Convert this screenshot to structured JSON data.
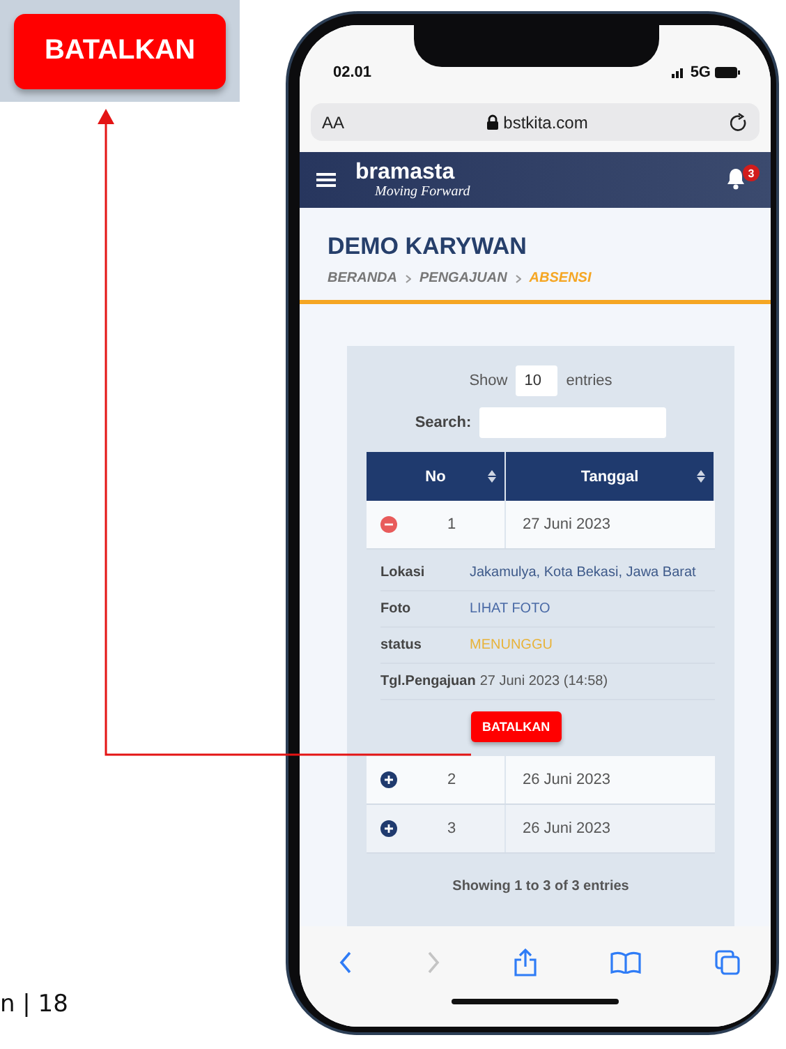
{
  "callout": {
    "button": "BATALKAN"
  },
  "footer": {
    "page_text": "n | 18"
  },
  "phone": {
    "status_bar": {
      "time": "02.01",
      "network": "5G"
    },
    "browser": {
      "text_size": "AA",
      "url": "bstkita.com"
    },
    "navbar": {
      "logo": "bramasta",
      "tagline": "Moving Forward",
      "notification_count": "3"
    },
    "header": {
      "title": "DEMO KARYWAN",
      "breadcrumb": [
        {
          "label": "BERANDA",
          "selected": false
        },
        {
          "label": "PENGAJUAN",
          "selected": false
        },
        {
          "label": "ABSENSI",
          "selected": true
        }
      ]
    },
    "table_controls": {
      "show_label": "Show",
      "page_size": "10",
      "entries_label": "entries",
      "search_label": "Search:"
    },
    "table": {
      "columns": [
        "No",
        "Tanggal"
      ],
      "rows": [
        {
          "no": "1",
          "tanggal": "27 Juni 2023",
          "expanded": true,
          "details": [
            {
              "kind": "text",
              "label": "Lokasi",
              "value": "Jakamulya, Kota Bekasi, Jawa Barat"
            },
            {
              "kind": "link",
              "label": "Foto",
              "value": "LIHAT FOTO"
            },
            {
              "kind": "status",
              "label": "status",
              "value": "MENUNGGU"
            },
            {
              "kind": "inline",
              "label": "Tgl.Pengajuan",
              "value": "27 Juni 2023 (14:58)"
            }
          ],
          "action": "BATALKAN"
        },
        {
          "no": "2",
          "tanggal": "26 Juni 2023",
          "expanded": false
        },
        {
          "no": "3",
          "tanggal": "26 Juni 2023",
          "expanded": false
        }
      ]
    },
    "info": "Showing 1 to 3 of 3 entries"
  }
}
